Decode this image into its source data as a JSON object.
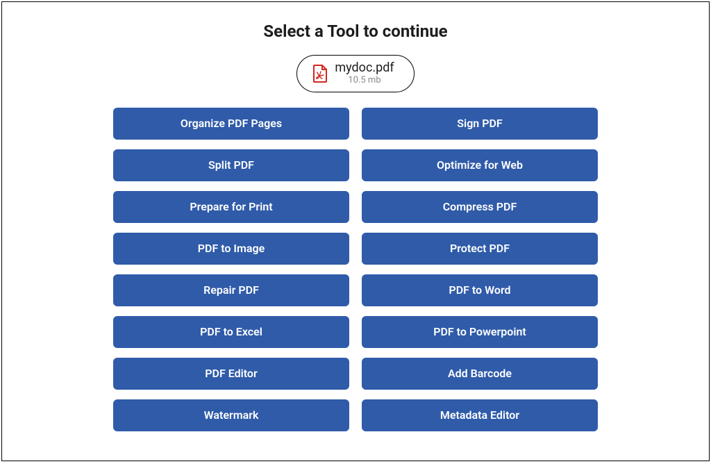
{
  "title": "Select a Tool to continue",
  "file": {
    "name": "mydoc.pdf",
    "size": "10.5 mb",
    "icon": "pdf-file-icon"
  },
  "tools": [
    {
      "label": "Organize PDF Pages",
      "name": "organize-pdf-pages-button"
    },
    {
      "label": "Sign PDF",
      "name": "sign-pdf-button"
    },
    {
      "label": "Split PDF",
      "name": "split-pdf-button"
    },
    {
      "label": "Optimize for Web",
      "name": "optimize-for-web-button"
    },
    {
      "label": "Prepare for Print",
      "name": "prepare-for-print-button"
    },
    {
      "label": "Compress PDF",
      "name": "compress-pdf-button"
    },
    {
      "label": "PDF to Image",
      "name": "pdf-to-image-button"
    },
    {
      "label": "Protect PDF",
      "name": "protect-pdf-button"
    },
    {
      "label": "Repair PDF",
      "name": "repair-pdf-button"
    },
    {
      "label": "PDF to Word",
      "name": "pdf-to-word-button"
    },
    {
      "label": "PDF to Excel",
      "name": "pdf-to-excel-button"
    },
    {
      "label": "PDF to Powerpoint",
      "name": "pdf-to-powerpoint-button"
    },
    {
      "label": "PDF Editor",
      "name": "pdf-editor-button"
    },
    {
      "label": "Add Barcode",
      "name": "add-barcode-button"
    },
    {
      "label": "Watermark",
      "name": "watermark-button"
    },
    {
      "label": "Metadata Editor",
      "name": "metadata-editor-button"
    }
  ],
  "colors": {
    "button_bg": "#2f5ba9",
    "button_text": "#ffffff",
    "pdf_icon": "#d3261f"
  }
}
